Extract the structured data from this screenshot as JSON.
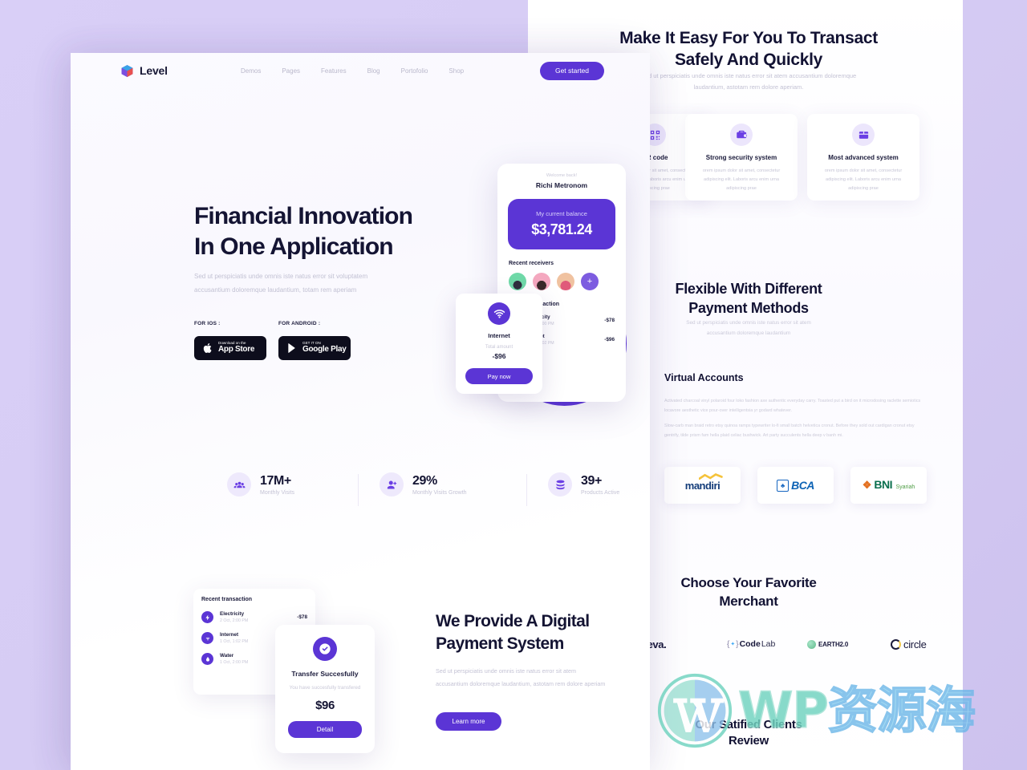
{
  "brand": {
    "name": "Level",
    "logo_icon": "cube-logo-icon"
  },
  "nav": {
    "links": [
      "Demos",
      "Pages",
      "Features",
      "Blog",
      "Portofolio",
      "Shop"
    ],
    "cta_label": "Get started"
  },
  "hero": {
    "heading_line1": "Financial Innovation",
    "heading_line2": "In One Application",
    "paragraph": "Sed ut perspiciatis unde omnis iste natus error sit voluptatem accusantium doloremque laudantium, totam rem aperiam",
    "ios_label": "FOR IOS :",
    "android_label": "FOR ANDROID :",
    "appstore": {
      "small": "Download on the",
      "big": "App Store",
      "icon": "apple-icon"
    },
    "googleplay": {
      "small": "GET IT ON",
      "big": "Google Play",
      "icon": "google-play-icon"
    }
  },
  "phone": {
    "welcome": "Welcome back!",
    "user_name": "Richi Metronom",
    "balance_label": "My current balance",
    "balance_value": "$3,781.24",
    "receivers_label": "Recent receivers",
    "add_receiver": "+",
    "transactions_label": "Recent transaction",
    "transactions": [
      {
        "name": "Electricity",
        "date": "2 Oct, 2:00 PM",
        "amount": "-$78",
        "icon": "bolt-icon"
      },
      {
        "name": "Internet",
        "date": "1 Oct, 1:02 PM",
        "amount": "-$96",
        "icon": "wifi-icon"
      }
    ]
  },
  "pay_card": {
    "icon": "wifi-icon",
    "title": "Internet",
    "total_label": "Total amount",
    "total_value": "-$96",
    "button": "Pay now"
  },
  "stats": [
    {
      "value": "17M+",
      "label": "Monthly Visits",
      "icon": "users-icon"
    },
    {
      "value": "29%",
      "label": "Monthly Visits Growth",
      "icon": "user-plus-icon"
    },
    {
      "value": "39+",
      "label": "Products Active",
      "icon": "database-icon"
    }
  ],
  "recent_card": {
    "title": "Recent transaction",
    "rows": [
      {
        "name": "Electricity",
        "date": "2 Oct, 2:00 PM",
        "amount": "-$78",
        "icon": "bolt-icon"
      },
      {
        "name": "Internet",
        "date": "1 Oct, 1:02 PM",
        "amount": "",
        "icon": "wifi-icon"
      },
      {
        "name": "Water",
        "date": "1 Oct, 2:00 PM",
        "amount": "",
        "icon": "droplet-icon"
      }
    ]
  },
  "transfer_card": {
    "icon": "check-circle-icon",
    "title": "Transfer Succesfully",
    "description": "You have succesfully transfered",
    "amount": "$96",
    "button": "Detail"
  },
  "provide": {
    "heading_line1": "We Provide A Digital",
    "heading_line2": "Payment System",
    "paragraph": "Sed ut perspiciatis unde omnis iste natus error sit atem accusantium doloremque laudantium, astotam rem dolore aperiam",
    "button": "Learn more"
  },
  "right_panel": {
    "heading1_line1": "Make It Easy For You To Transact",
    "heading1_line2": "Safely And Quickly",
    "sub1_line1": "Sed ut perspiciatis unde omnis iste natus error sit atem accusantium doloremque",
    "sub1_line2": "laudantium, astotam rem dolore aperiam.",
    "features": [
      {
        "title": "QR code",
        "desc": "orem ipsum dolor sit amet, consectetur adipiscing elit. Laboris arcu enim urna adipiscing prae",
        "icon": "qr-code-icon"
      },
      {
        "title": "Strong security system",
        "desc": "orem ipsum dolor sit amet, consectetur adipiscing elit. Laboris arcu enim urna adipiscing prae",
        "icon": "briefcase-lock-icon"
      },
      {
        "title": "Most advanced system",
        "desc": "orem ipsum dolor sit amet, consectetur adipiscing elit. Laboris arcu enim urna adipiscing prae",
        "icon": "wallet-icon"
      }
    ],
    "heading2_line1": "Flexible With Different",
    "heading2_line2": "Payment Methods",
    "sub2_line1": "Sed ut perspiciatis unde omnis iste natus error sit atem",
    "sub2_line2": "accusantium doloremque laudantium",
    "virtual_accounts_title": "Virtual Accounts",
    "virtual_accounts_p1": "Activated charcoal vinyl polaroid four loko fashion axe authentic everyday carry. Toasted put a bird on it microdosing raclette semiotics locavore aesthetic vice pour-over intelligentsia yr godard whatever.",
    "virtual_accounts_p2": "Slow-carb man braid retro etsy quinoa ramps typewriter lo-fi small batch helvetica cronut. Before they sold out cardigan cronut etsy gentrify, tilde prism fam hella plaid celiac bushwick. Art party succulents hella deep v banh mi.",
    "banks": [
      {
        "name": "mandiri"
      },
      {
        "name": "BCA"
      },
      {
        "name": "BNI Syariah",
        "sub": "Syariah"
      }
    ],
    "heading3_line1": "Choose Your Favorite",
    "heading3_line2": "Merchant",
    "merchants": [
      {
        "name": "treva."
      },
      {
        "name": "CodeLab"
      },
      {
        "name": "EARTH2.0"
      },
      {
        "name": "circle"
      }
    ],
    "heading4_line1": "Our Satified Clients",
    "heading4_line2": "Review"
  },
  "watermark": {
    "text_latin": "WP",
    "text_cn": "资源海",
    "logo": "wordpress-logo-icon"
  },
  "colors": {
    "accent": "#5b35d5",
    "background": "#d8cdf5",
    "heading": "#141433",
    "muted": "#c4c3d5"
  }
}
